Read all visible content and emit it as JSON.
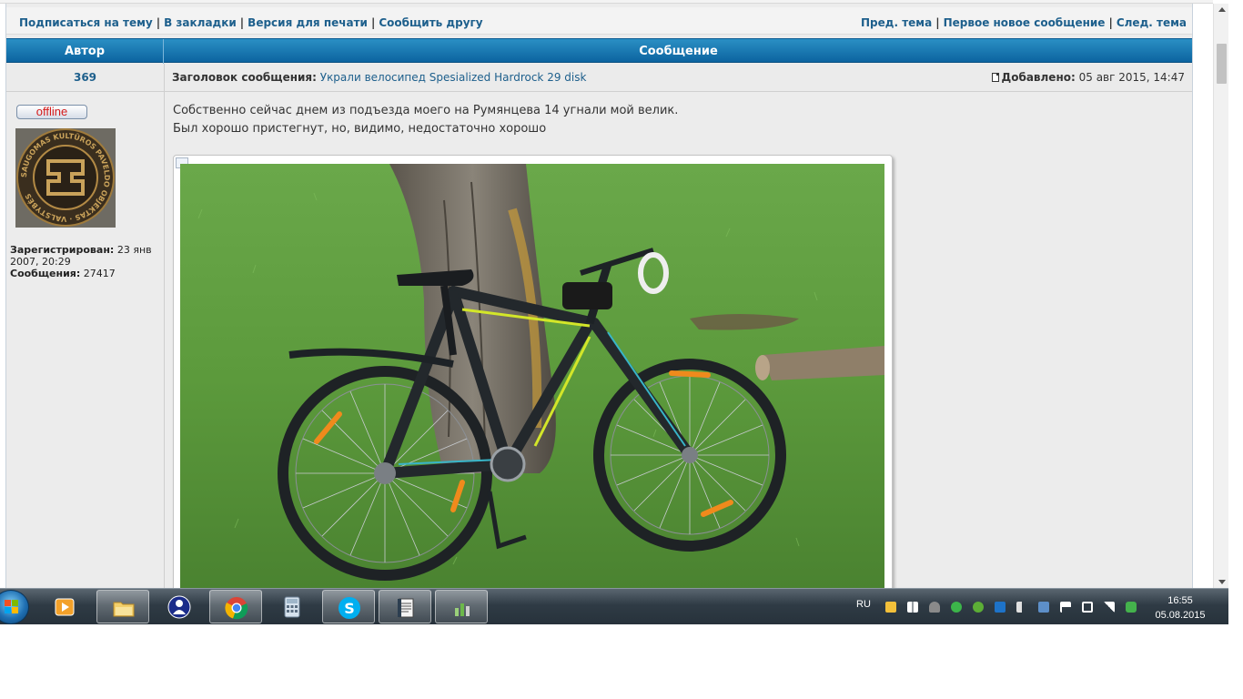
{
  "nav": {
    "subscribe": "Подписаться на тему",
    "bookmarks": "В закладки",
    "print": "Версия для печати",
    "tell_friend": "Сообщить другу",
    "prev_topic": "Пред. тема",
    "first_new": "Первое новое сообщение",
    "next_topic": "След. тема",
    "separator": "|"
  },
  "table_header": {
    "author": "Автор",
    "message": "Сообщение"
  },
  "post": {
    "author_name": "369",
    "subject_label": "Заголовок сообщения:",
    "subject": "Украли велосипед Spesialized Hardrock 29 disk",
    "added_label": "Добавлено:",
    "added_date": "05 авг 2015, 14:47",
    "status": "offline",
    "registered_label": "Зарегистрирован:",
    "registered_value": "23 янв 2007, 20:29",
    "messages_label": "Сообщения:",
    "messages_value": "27417",
    "body_line1": "Собственно сейчас днем из подъезда моего на Румянцева 14 угнали мой велик.",
    "body_line2": "Был хорошо пристегнут, но, видимо, недостаточно хорошо",
    "avatar_seal_text": "SAUGOMAS KULTŪROS PAVELDO OBJEKTAS · VALSTYBĖS"
  },
  "taskbar": {
    "language": "RU",
    "time": "16:55",
    "date": "05.08.2015",
    "apps": [
      "media-player-icon",
      "file-explorer-icon",
      "user-icon",
      "chrome-icon",
      "calculator-icon",
      "skype-icon",
      "notepad-icon",
      "chart-app-icon"
    ]
  },
  "colors": {
    "link": "#1d5f8c",
    "header_blue": "#0c64a0",
    "offline_red": "#d41a1a"
  }
}
